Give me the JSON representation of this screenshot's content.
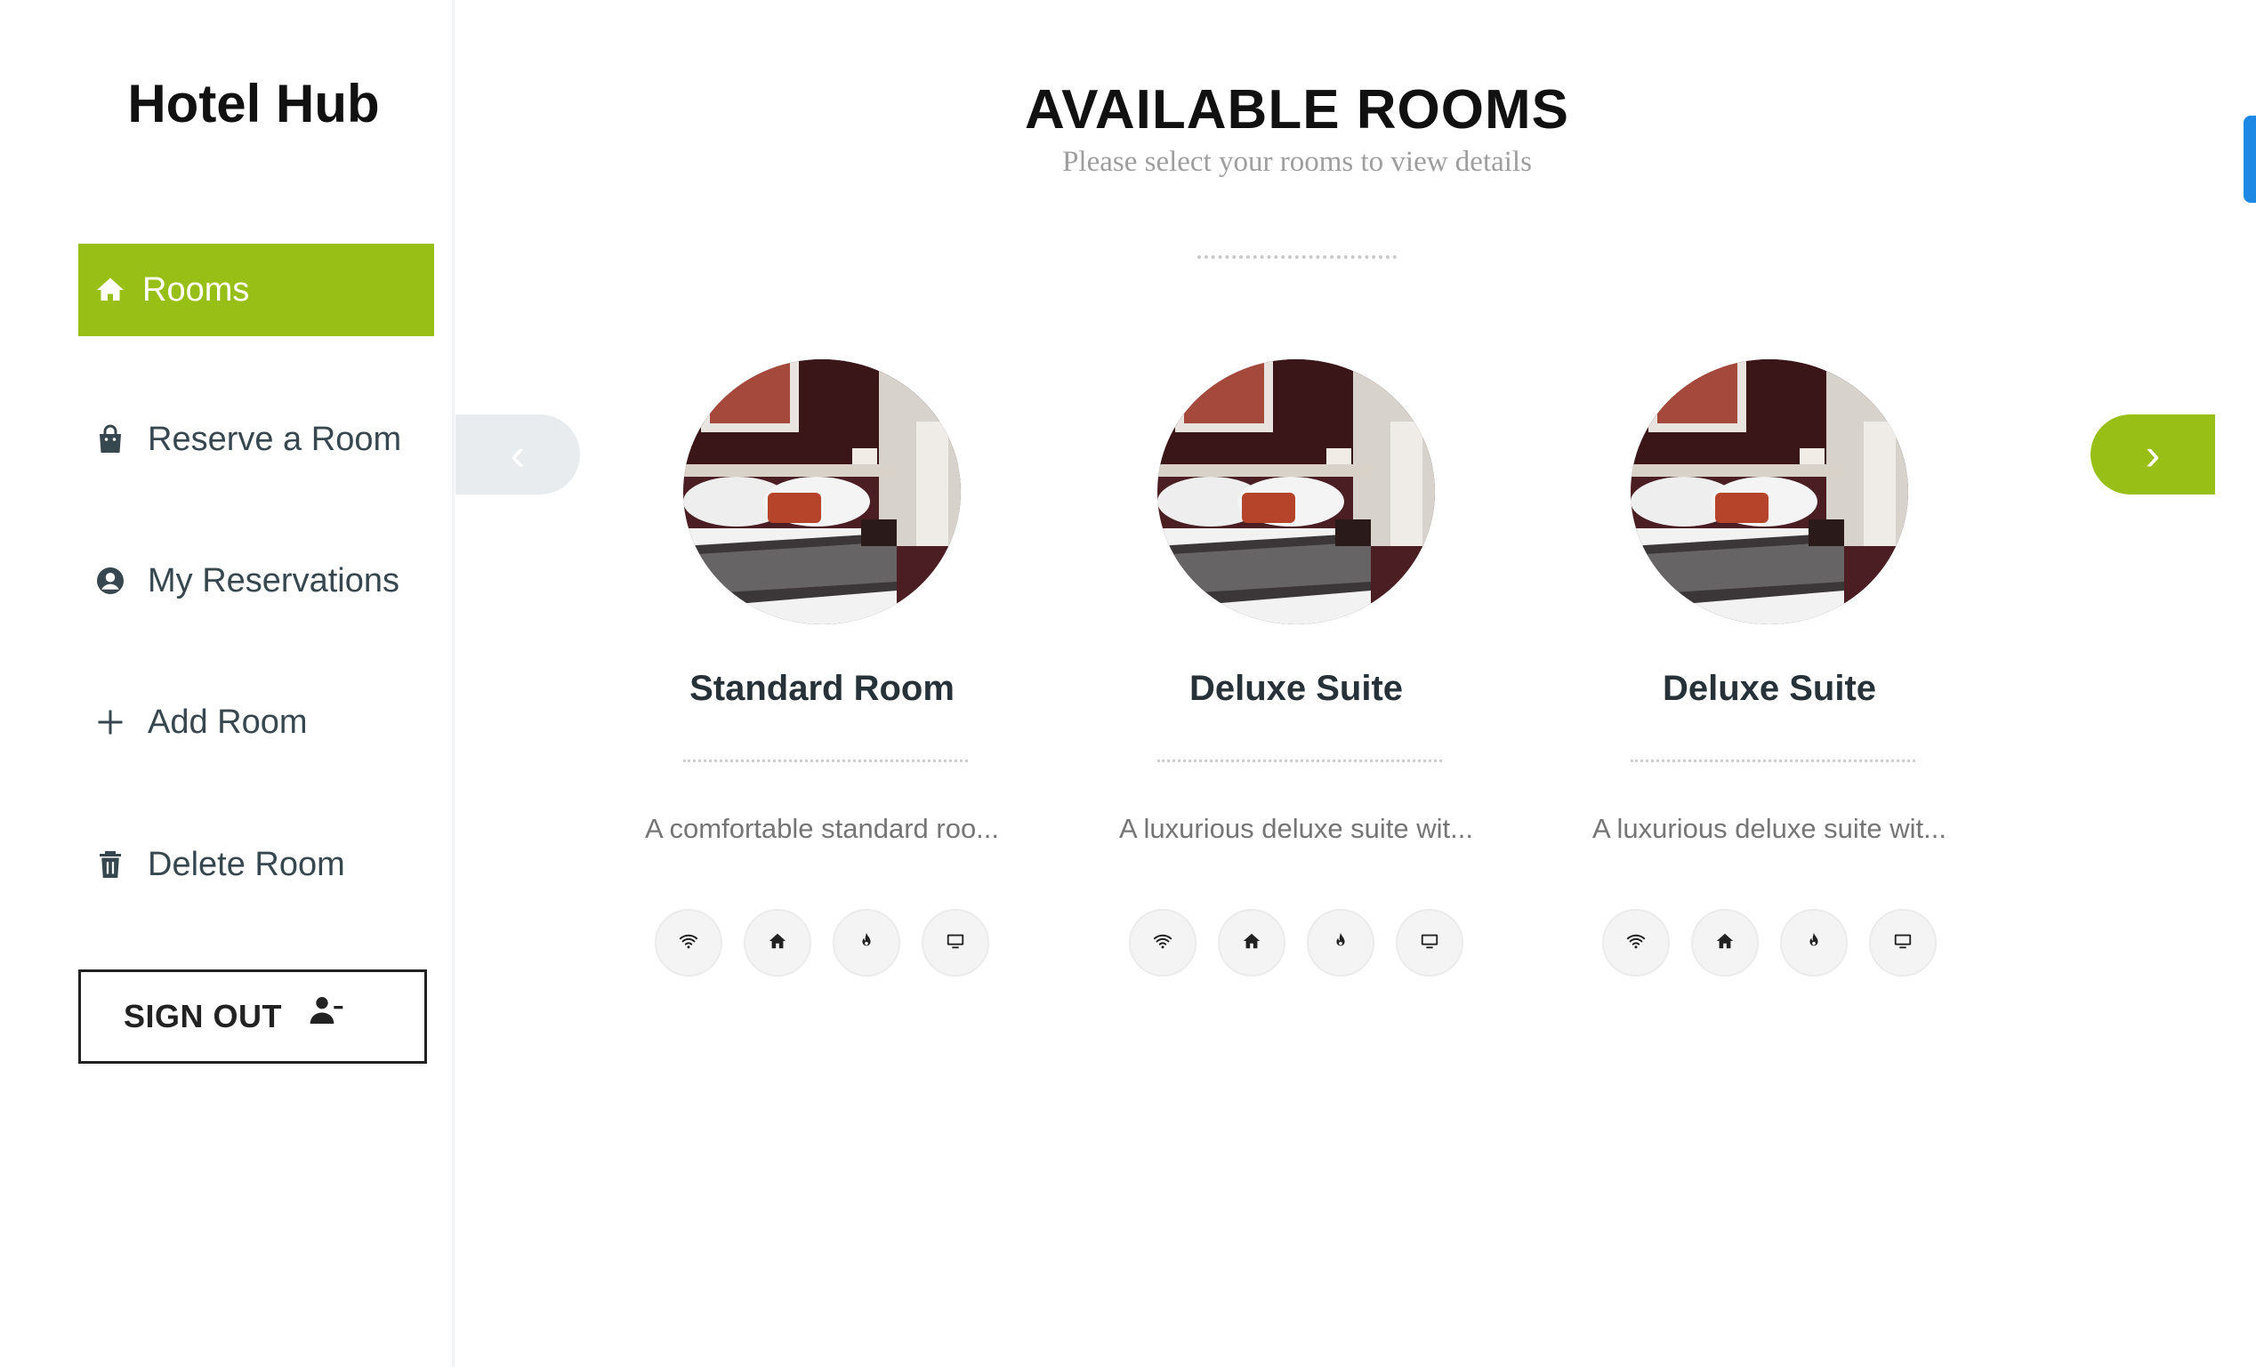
{
  "sidebar": {
    "brand": "Hotel Hub",
    "items": [
      {
        "label": "Rooms",
        "icon": "home-icon",
        "active": true
      },
      {
        "label": "Reserve a Room",
        "icon": "shopping-bag-icon",
        "active": false
      },
      {
        "label": "My Reservations",
        "icon": "user-circle-icon",
        "active": false
      },
      {
        "label": "Add Room",
        "icon": "plus-icon",
        "active": false
      },
      {
        "label": "Delete Room",
        "icon": "trash-icon",
        "active": false
      }
    ],
    "signout_label": "SIGN OUT",
    "signout_icon": "user-minus-icon"
  },
  "main": {
    "title": "AVAILABLE ROOMS",
    "subtitle": "Please select your rooms to view details",
    "prev_label": "‹",
    "next_label": "›",
    "rooms": [
      {
        "name": "Standard Room",
        "description": "A comfortable standard roo..."
      },
      {
        "name": "Deluxe Suite",
        "description": "A luxurious deluxe suite wit..."
      },
      {
        "name": "Deluxe Suite",
        "description": "A luxurious deluxe suite wit..."
      }
    ],
    "amenity_icons": [
      "wifi-icon",
      "home-icon",
      "fire-icon",
      "tv-icon"
    ]
  },
  "colors": {
    "accent": "#97bf16",
    "edge_tab": "#1e88e5",
    "text_dark": "#263238"
  }
}
